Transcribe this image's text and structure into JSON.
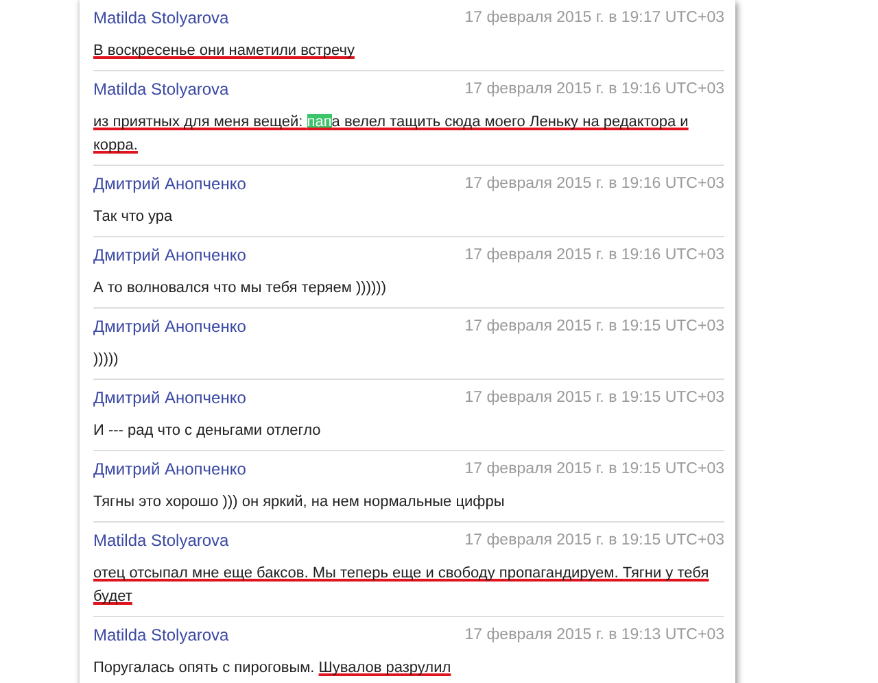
{
  "messages": [
    {
      "author": "Matilda Stolyarova",
      "time": "17 февраля 2015 г. в 19:17 UTC+03",
      "text": [
        {
          "text": "В воскресенье они наметили встречу",
          "underlined": true,
          "highlighted": false
        }
      ]
    },
    {
      "author": "Matilda Stolyarova",
      "time": "17 февраля 2015 г. в 19:16 UTC+03",
      "text": [
        {
          "text": "из приятных для меня вещей: ",
          "underlined": true,
          "highlighted": false
        },
        {
          "text": "пап",
          "underlined": true,
          "highlighted": true
        },
        {
          "text": "а велел тащить сюда моего Леньку на редактора и корра.",
          "underlined": true,
          "highlighted": false
        }
      ]
    },
    {
      "author": "Дмитрий Анопченко",
      "time": "17 февраля 2015 г. в 19:16 UTC+03",
      "text": [
        {
          "text": "Так что ура",
          "underlined": false,
          "highlighted": false
        }
      ]
    },
    {
      "author": "Дмитрий Анопченко",
      "time": "17 февраля 2015 г. в 19:16 UTC+03",
      "text": [
        {
          "text": "А то волновался что мы тебя теряем ))))))",
          "underlined": false,
          "highlighted": false
        }
      ]
    },
    {
      "author": "Дмитрий Анопченко",
      "time": "17 февраля 2015 г. в 19:15 UTC+03",
      "text": [
        {
          "text": ")))))",
          "underlined": false,
          "highlighted": false
        }
      ]
    },
    {
      "author": "Дмитрий Анопченко",
      "time": "17 февраля 2015 г. в 19:15 UTC+03",
      "text": [
        {
          "text": "И --- рад что с деньгами отлегло",
          "underlined": false,
          "highlighted": false
        }
      ]
    },
    {
      "author": "Дмитрий Анопченко",
      "time": "17 февраля 2015 г. в 19:15 UTC+03",
      "text": [
        {
          "text": "Тягны это хорошо ))) он яркий, на нем нормальные цифры",
          "underlined": false,
          "highlighted": false
        }
      ]
    },
    {
      "author": "Matilda Stolyarova",
      "time": "17 февраля 2015 г. в 19:15 UTC+03",
      "text": [
        {
          "text": "отец отсыпал мне еще баксов. Мы теперь еще и свободу пропагандируем. Тягни у тебя будет",
          "underlined": true,
          "highlighted": false
        }
      ]
    },
    {
      "author": "Matilda Stolyarova",
      "time": "17 февраля 2015 г. в 19:13 UTC+03",
      "text": [
        {
          "text": "Поругалась опять с пироговым. ",
          "underlined": false,
          "highlighted": false
        },
        {
          "text": "Шувалов разрулил",
          "underlined": true,
          "highlighted": false
        }
      ]
    }
  ]
}
